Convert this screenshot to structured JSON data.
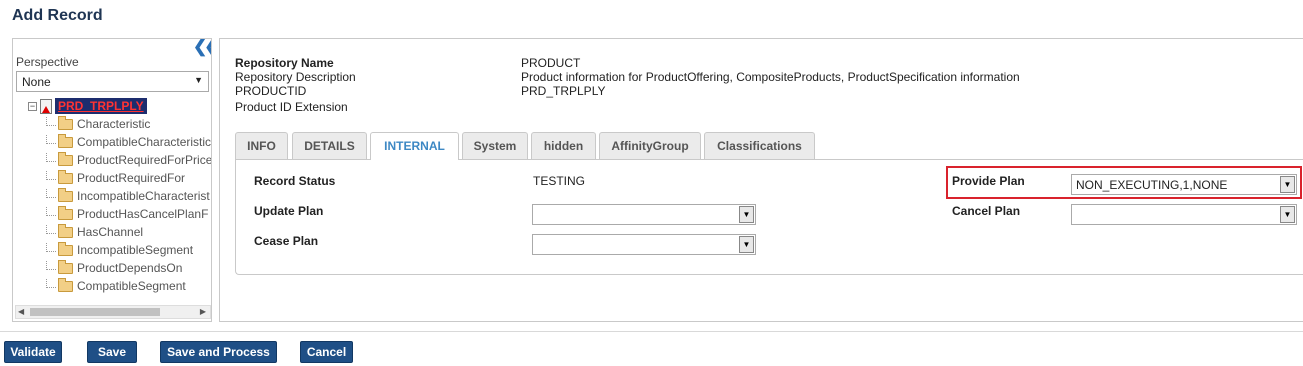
{
  "page": {
    "title": "Add Record"
  },
  "perspective": {
    "label": "Perspective",
    "value": "None"
  },
  "tree": {
    "root": "PRD_TRPLPLY",
    "children": [
      "Characteristic",
      "CompatibleCharacteristic",
      "ProductRequiredForPrice",
      "ProductRequiredFor",
      "IncompatibleCharacterist",
      "ProductHasCancelPlanF",
      "HasChannel",
      "IncompatibleSegment",
      "ProductDependsOn",
      "CompatibleSegment"
    ]
  },
  "record_info": {
    "repo_name_label": "Repository Name",
    "repo_name_value": "PRODUCT",
    "repo_desc_label": "Repository Description",
    "repo_desc_value": "Product information for ProductOffering, CompositeProducts, ProductSpecification information",
    "product_id_label": "PRODUCTID",
    "product_id_value": "PRD_TRPLPLY",
    "product_id_ext_label": "Product ID Extension"
  },
  "tabs": [
    "INFO",
    "DETAILS",
    "INTERNAL",
    "System",
    "hidden",
    "AffinityGroup",
    "Classifications"
  ],
  "active_tab": "INTERNAL",
  "internal": {
    "record_status_label": "Record Status",
    "record_status_value": "TESTING",
    "update_plan_label": "Update Plan",
    "update_plan_value": "",
    "cease_plan_label": "Cease Plan",
    "cease_plan_value": "",
    "provide_plan_label": "Provide Plan",
    "provide_plan_value": "NON_EXECUTING,1,NONE",
    "cancel_plan_label": "Cancel Plan",
    "cancel_plan_value": ""
  },
  "buttons": {
    "validate": "Validate",
    "save": "Save",
    "save_process": "Save and Process",
    "cancel": "Cancel"
  },
  "colors": {
    "button_bg": "#1f4f86",
    "active_tab": "#3d88c4",
    "highlight": "#d9232d",
    "root_bg": "#1d2d6e"
  }
}
